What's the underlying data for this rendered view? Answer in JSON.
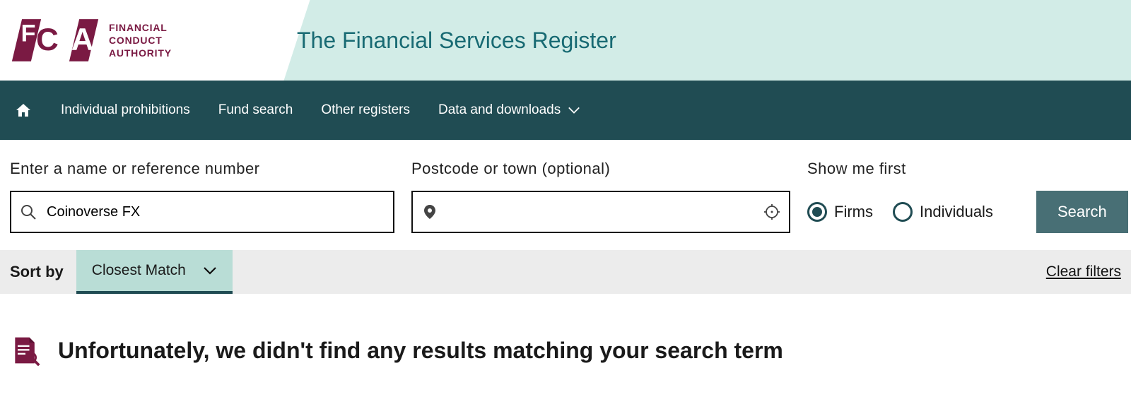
{
  "logo": {
    "line1": "FINANCIAL",
    "line2": "CONDUCT",
    "line3": "AUTHORITY"
  },
  "header": {
    "title": "The Financial Services Register"
  },
  "nav": {
    "items": [
      {
        "label": "Individual prohibitions"
      },
      {
        "label": "Fund search"
      },
      {
        "label": "Other registers"
      },
      {
        "label": "Data and downloads"
      }
    ]
  },
  "search": {
    "name_label": "Enter a name or reference number",
    "name_value": "Coinoverse FX",
    "postcode_label": "Postcode or town (optional)",
    "postcode_value": "",
    "showfirst_label": "Show me first",
    "radio_firms": "Firms",
    "radio_individuals": "Individuals",
    "button": "Search"
  },
  "sort": {
    "label": "Sort by",
    "selected": "Closest Match",
    "clear": "Clear filters"
  },
  "results": {
    "none_heading": "Unfortunately, we didn't find any results matching your search term"
  }
}
